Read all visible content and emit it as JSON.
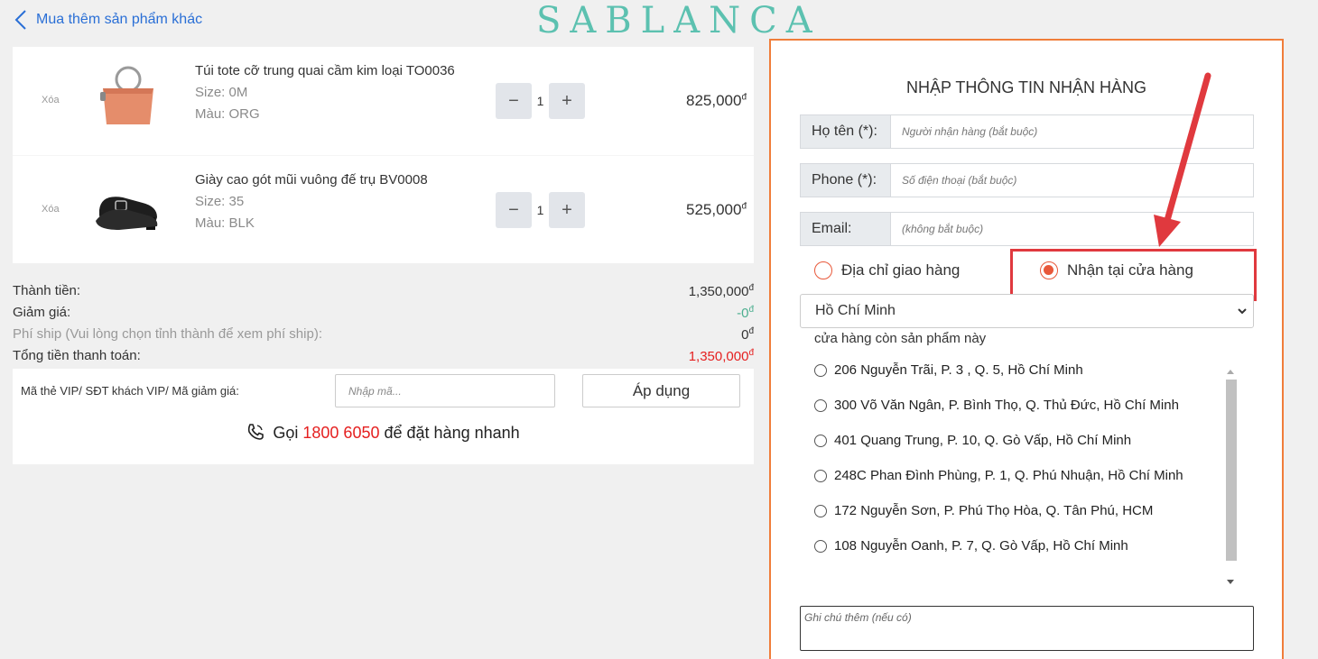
{
  "nav": {
    "back_label": "Mua thêm sản phẩm khác"
  },
  "brand": {
    "logo_text": "SABLANCA",
    "logo_color": "#5cc1b0"
  },
  "cart": {
    "items": [
      {
        "remove_label": "Xóa",
        "name": "Túi tote cỡ trung quai cầm kim loại TO0036",
        "size": "Size: 0M",
        "color": "Màu: ORG",
        "quantity": "1",
        "price": "825,000",
        "currency": "đ",
        "image_icon": "orange-tote-bag"
      },
      {
        "remove_label": "Xóa",
        "name": "Giày cao gót mũi vuông đế trụ BV0008",
        "size": "Size: 35",
        "color": "Màu: BLK",
        "quantity": "1",
        "price": "525,000",
        "currency": "đ",
        "image_icon": "black-heel-shoe"
      }
    ],
    "minus_symbol": "−",
    "plus_symbol": "+"
  },
  "summary": {
    "subtotal_label": "Thành tiền:",
    "subtotal_value": "1,350,000",
    "discount_label": "Giảm giá:",
    "discount_value": "-0",
    "shipping_label": "Phí ship (Vui lòng chọn tỉnh thành để xem phí ship):",
    "shipping_value": "0",
    "total_label": "Tổng tiền thanh toán:",
    "total_value": "1,350,000",
    "currency": "đ",
    "discount_color": "#4cae8f",
    "total_color": "#e52020"
  },
  "promo": {
    "label": "Mã thẻ VIP/ SĐT khách VIP/ Mã giảm giá:",
    "placeholder": "Nhập mã...",
    "apply_label": "Áp dụng",
    "hotline_prefix": "Gọi",
    "hotline_number": "1800 6050",
    "hotline_suffix": "để đặt hàng nhanh"
  },
  "form": {
    "title": "NHẬP THÔNG TIN NHẬN HÀNG",
    "name_label": "Họ tên (*):",
    "name_placeholder": "Người nhận hàng (bắt buộc)",
    "phone_label": "Phone (*):",
    "phone_placeholder": "Số điện thoại (bắt buộc)",
    "email_label": "Email:",
    "email_placeholder": "(không bắt buộc)",
    "delivery_option_label": "Địa chỉ giao hàng",
    "pickup_option_label": "Nhận tại cửa hàng",
    "selected_option": "pickup",
    "city_value": "Hồ Chí Minh",
    "stores_hint": "cửa hàng còn sản phẩm này",
    "stores": [
      "206 Nguyễn Trãi, P. 3 , Q. 5, Hồ Chí Minh",
      "300 Võ Văn Ngân, P. Bình Thọ, Q. Thủ Đức, Hồ Chí Minh",
      "401 Quang Trung, P. 10, Q. Gò Vấp, Hồ Chí Minh",
      "248C Phan Đình Phùng, P. 1, Q. Phú Nhuận, Hồ Chí Minh",
      "172 Nguyễn Sơn, P. Phú Thọ Hòa, Q. Tân Phú, HCM",
      "108 Nguyễn Oanh, P. 7, Q. Gò Vấp, Hồ Chí Minh"
    ],
    "note_placeholder": "Ghi chú thêm (nếu có)",
    "accent_color": "#f07d3a",
    "annotation_color": "#e0393e"
  }
}
